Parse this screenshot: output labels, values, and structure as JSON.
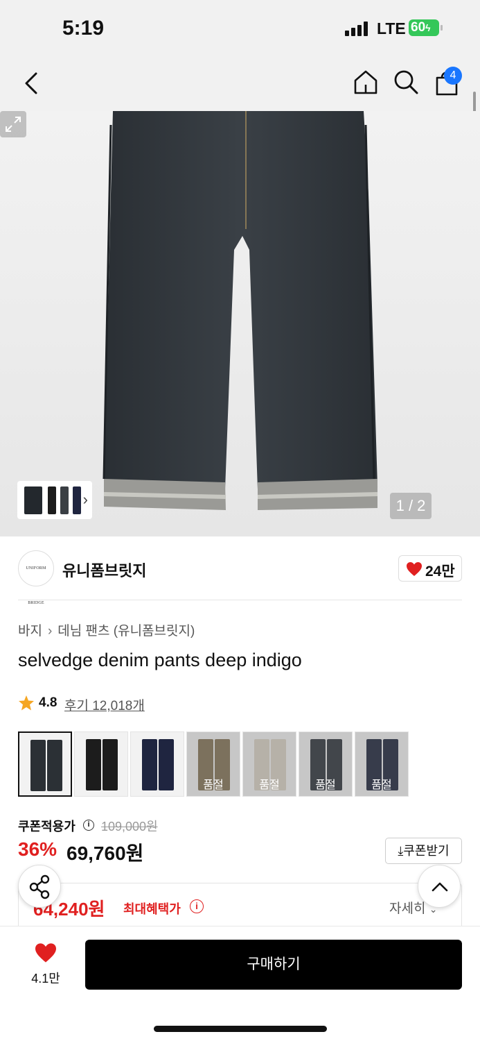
{
  "status": {
    "time": "5:19",
    "carrier": "LTE",
    "battery": "60"
  },
  "nav": {
    "cart_count": "4"
  },
  "hero": {
    "pager": "1 / 2"
  },
  "brand": {
    "name": "유니폼브릿지",
    "logo_text": "UNIFORM BRIDGE",
    "likes": "24만"
  },
  "breadcrumb": {
    "category": "바지",
    "subcategory": "데님 팬츠 (유니폼브릿지)"
  },
  "product": {
    "title": "selvedge denim pants deep indigo",
    "rating": "4.8",
    "reviews": "후기 12,018개"
  },
  "swatches": [
    {
      "color": "#2b3035",
      "soldout": false,
      "selected": true
    },
    {
      "color": "#1c1c1c",
      "soldout": false,
      "selected": false
    },
    {
      "color": "#1f2540",
      "soldout": false,
      "selected": false
    },
    {
      "color": "#7e6d4f",
      "soldout": true,
      "selected": false
    },
    {
      "color": "#d8d0c2",
      "soldout": true,
      "selected": false
    },
    {
      "color": "#262b33",
      "soldout": true,
      "selected": false
    },
    {
      "color": "#151c33",
      "soldout": true,
      "selected": false
    }
  ],
  "soldout_label": "품절",
  "price": {
    "coupon_label": "쿠폰적용가",
    "original": "109,000원",
    "discount": "36%",
    "sale": "69,760원",
    "coupon_button": "쿠폰받기",
    "max_price": "64,240원",
    "max_label": "최대혜택가",
    "detail": "자세히"
  },
  "bottom": {
    "wish_count": "4.1만",
    "buy_label": "구매하기"
  },
  "colors": {
    "accent_red": "#e02020",
    "badge_blue": "#1976ff",
    "battery_green": "#34c759"
  }
}
